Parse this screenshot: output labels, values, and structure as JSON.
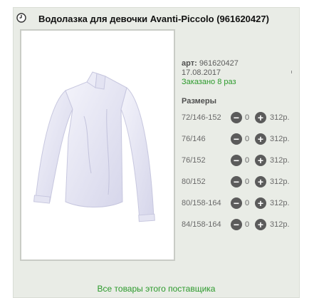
{
  "product": {
    "title": "Водолазка для девочки Avanti-Piccolo (961620427)",
    "art_label": "арт:",
    "art_value": "961620427",
    "date": "17.08.2017",
    "ordered": "Заказано 8 раз",
    "image_icon": "white-turtleneck-shirt-photo"
  },
  "sizes_heading": "Размеры",
  "sizes": [
    {
      "size": "72/146-152",
      "qty": "0",
      "price": "312р."
    },
    {
      "size": "76/146",
      "qty": "0",
      "price": "312р."
    },
    {
      "size": "76/152",
      "qty": "0",
      "price": "312р."
    },
    {
      "size": "80/152",
      "qty": "0",
      "price": "312р."
    },
    {
      "size": "80/158-164",
      "qty": "0",
      "price": "312р."
    },
    {
      "size": "84/158-164",
      "qty": "0",
      "price": "312р."
    }
  ],
  "buttons": {
    "minus": "−",
    "plus": "+"
  },
  "footer_link": "Все товары этого поставщика",
  "colors": {
    "accent_green": "#2c9a2c",
    "card_bg": "#e9ece6",
    "button_gray": "#5b5b5b"
  }
}
